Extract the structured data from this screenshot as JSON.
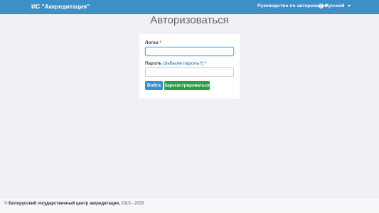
{
  "navbar": {
    "brand": "ИС \"Аккредитация\"",
    "guide_link": "Руководство по авторизации",
    "language": "Русский",
    "language_icon": "globe-icon"
  },
  "page": {
    "title": "Авторизоваться"
  },
  "form": {
    "login_label": "Логин",
    "password_label": "Пароль",
    "forgot_password": "(Забыли пароль?)",
    "required_mark": "*",
    "login_value": "",
    "password_value": "",
    "login_button": "Войти",
    "register_button": "Зарегистрироваться"
  },
  "footer": {
    "copyright": "©",
    "organization": "Белорусский государственный центр аккредитации,",
    "years": "2015 - 2025"
  },
  "colors": {
    "navbar": "#3d8fc7",
    "login_button": "#3d8fc7",
    "register_button": "#2a9d4a",
    "required": "#d9534f",
    "background": "#eff1f6"
  }
}
